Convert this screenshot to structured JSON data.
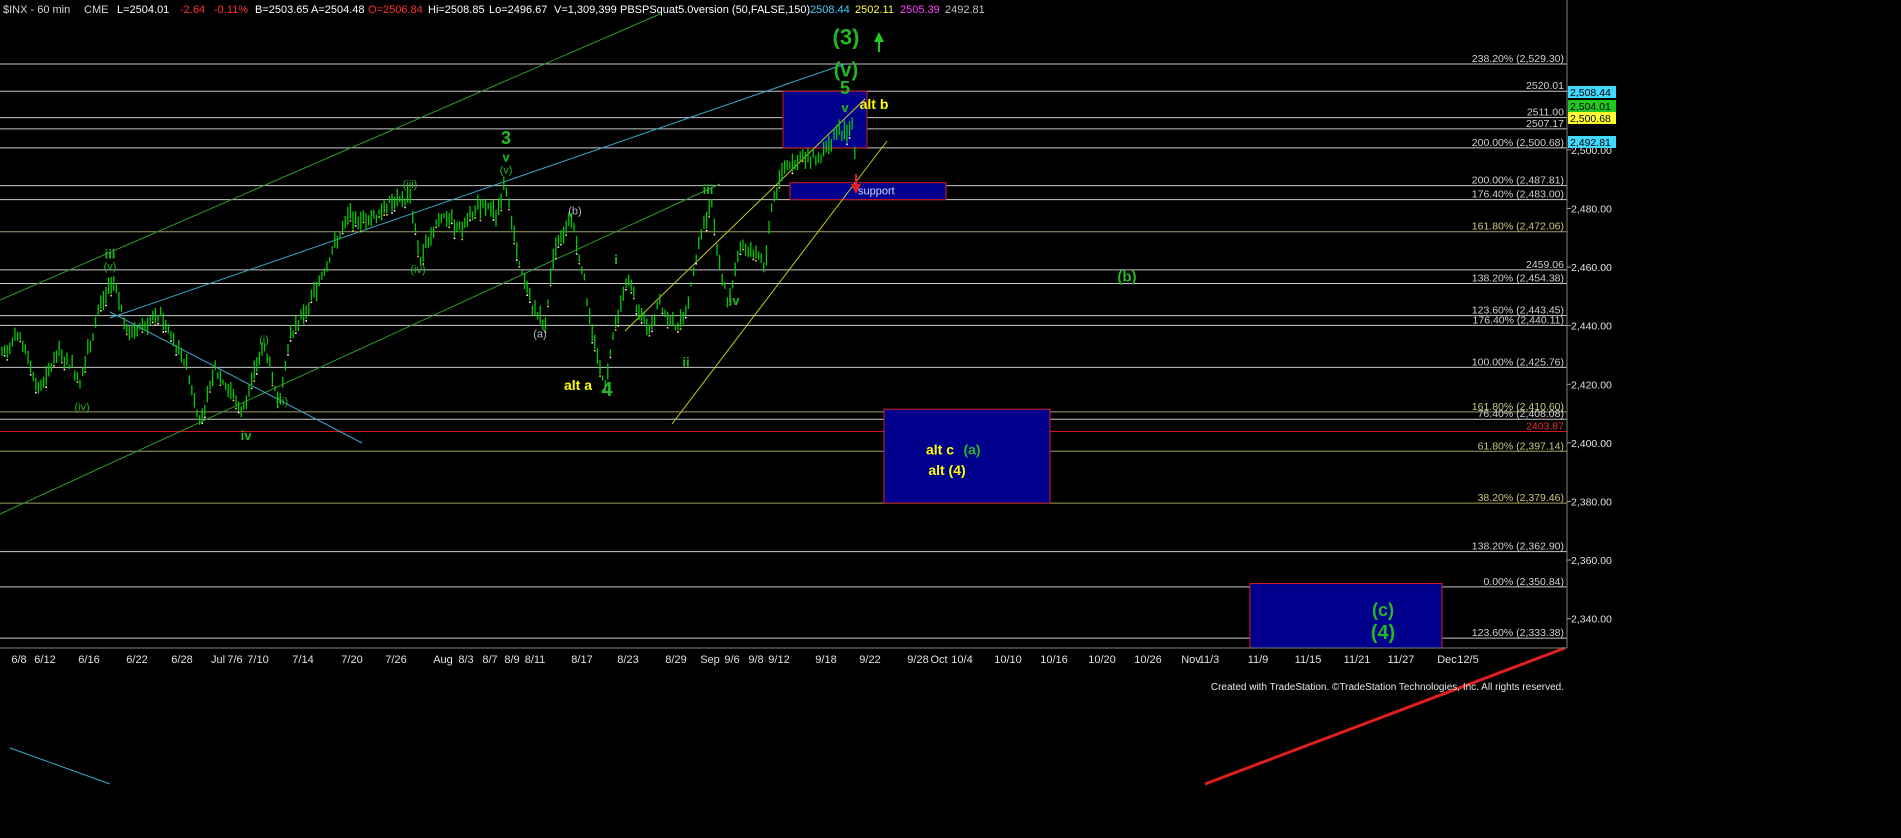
{
  "header": {
    "symbol": "$INX - 60 min",
    "exchange": "CME",
    "last": "L=2504.01",
    "change": "-2.64",
    "pct": "-0.11%",
    "bid": "B=2503.65",
    "ask": "A=2504.48",
    "open": "O=2506.84",
    "high": "Hi=2508.85",
    "low": "Lo=2496.67",
    "volume": "V=1,309,399",
    "study": "PBSPSquat5.0version (50,FALSE,150)",
    "v1": "2508.44",
    "v2": "2502.11",
    "v3": "2505.39",
    "v4": "2492.81"
  },
  "footer": "Created with TradeStation. ©TradeStation Technologies, Inc. All rights reserved.",
  "colors": {
    "background": "#000000",
    "up_bar": "#00cc00",
    "hline": "#c8c8c8",
    "red_line": "#d01818",
    "box_fill": "#00008c",
    "box_border": "#d02020",
    "green_label": "#22b822",
    "yellow_label": "#ffff00"
  },
  "chart_data": {
    "type": "candlestick",
    "ylim": [
      2330,
      2545
    ],
    "y_ticks": [
      "2,520.00",
      "2,500.00",
      "2,480.00",
      "2,460.00",
      "2,440.00",
      "2,420.00",
      "2,400.00",
      "2,380.00",
      "2,360.00",
      "2,340.00"
    ],
    "x_ticks": [
      "6/8",
      "6/12",
      "6/16",
      "6/22",
      "6/28",
      "Jul",
      "7/6",
      "7/10",
      "7/14",
      "7/20",
      "7/26",
      "Aug",
      "8/3",
      "8/7",
      "8/9",
      "8/11",
      "8/17",
      "8/23",
      "8/29",
      "Sep",
      "9/6",
      "9/8",
      "9/12",
      "9/18",
      "9/22",
      "9/28",
      "Oct",
      "10/4",
      "10/10",
      "10/16",
      "10/20",
      "10/26",
      "Nov",
      "11/3",
      "11/9",
      "11/15",
      "11/21",
      "11/27",
      "Dec",
      "12/5"
    ],
    "price_tags": [
      "2,508.44",
      "2,504.01",
      "2,500.68",
      "2,492.81"
    ],
    "levels": [
      {
        "label": "238.20% (2,529.30)",
        "value": 2529.3
      },
      {
        "label": "2520.01",
        "value": 2520.01
      },
      {
        "label": "2511.00",
        "value": 2511.0
      },
      {
        "label": "2507.17",
        "value": 2507.17
      },
      {
        "label": "200.00% (2,500.68)",
        "value": 2500.68
      },
      {
        "label": "200.00% (2,487.81)",
        "value": 2487.81
      },
      {
        "label": "176.40% (2,483.00)",
        "value": 2483.0
      },
      {
        "label": "161.80% (2,472.06)",
        "value": 2472.06
      },
      {
        "label": "2459.06",
        "value": 2459.06
      },
      {
        "label": "138.20% (2,454.38)",
        "value": 2454.38
      },
      {
        "label": "123.60% (2,443.45)",
        "value": 2443.45
      },
      {
        "label": "176.40% (2,440.11)",
        "value": 2440.11
      },
      {
        "label": "100.00% (2,425.76)",
        "value": 2425.76
      },
      {
        "label": "161.80% (2,410.60)",
        "value": 2410.6
      },
      {
        "label": "76.40% (2,408.08)",
        "value": 2408.08
      },
      {
        "label": "2403.87",
        "value": 2403.87
      },
      {
        "label": "61.80% (2,397.14)",
        "value": 2397.14
      },
      {
        "label": "38.20% (2,379.46)",
        "value": 2379.46
      },
      {
        "label": "138.20% (2,362.90)",
        "value": 2362.9
      },
      {
        "label": "0.00% (2,350.84)",
        "value": 2350.84
      },
      {
        "label": "123.60% (2,333.38)",
        "value": 2333.38
      }
    ],
    "path": [
      [
        0,
        2430
      ],
      [
        20,
        2436
      ],
      [
        40,
        2418
      ],
      [
        60,
        2432
      ],
      [
        80,
        2422
      ],
      [
        100,
        2446
      ],
      [
        112,
        2455
      ],
      [
        130,
        2437
      ],
      [
        160,
        2444
      ],
      [
        185,
        2428
      ],
      [
        200,
        2408
      ],
      [
        215,
        2425
      ],
      [
        230,
        2418
      ],
      [
        242,
        2410
      ],
      [
        255,
        2427
      ],
      [
        265,
        2433
      ],
      [
        278,
        2413
      ],
      [
        290,
        2437
      ],
      [
        310,
        2448
      ],
      [
        330,
        2464
      ],
      [
        350,
        2478
      ],
      [
        370,
        2476
      ],
      [
        390,
        2482
      ],
      [
        410,
        2484
      ],
      [
        420,
        2462
      ],
      [
        440,
        2478
      ],
      [
        460,
        2473
      ],
      [
        480,
        2481
      ],
      [
        497,
        2478
      ],
      [
        505,
        2490
      ],
      [
        518,
        2462
      ],
      [
        530,
        2448
      ],
      [
        545,
        2440
      ],
      [
        555,
        2468
      ],
      [
        572,
        2476
      ],
      [
        583,
        2458
      ],
      [
        595,
        2432
      ],
      [
        605,
        2419
      ],
      [
        615,
        2441
      ],
      [
        628,
        2456
      ],
      [
        640,
        2443
      ],
      [
        650,
        2440
      ],
      [
        660,
        2448
      ],
      [
        672,
        2440
      ],
      [
        685,
        2442
      ],
      [
        700,
        2470
      ],
      [
        712,
        2483
      ],
      [
        720,
        2460
      ],
      [
        728,
        2447
      ],
      [
        740,
        2467
      ],
      [
        755,
        2466
      ],
      [
        765,
        2460
      ],
      [
        772,
        2482
      ],
      [
        785,
        2495
      ],
      [
        800,
        2498
      ],
      [
        818,
        2497
      ],
      [
        830,
        2504
      ],
      [
        842,
        2506
      ],
      [
        852,
        2508
      ],
      [
        856,
        2498
      ]
    ],
    "waves": [
      {
        "text": "iii",
        "price": 2463,
        "x": 110,
        "color": "green",
        "size": 13,
        "bold": true
      },
      {
        "text": "(v)",
        "price": 2459,
        "x": 110,
        "color": "green",
        "size": 11
      },
      {
        "text": "(iv)",
        "price": 2411,
        "x": 82,
        "color": "green",
        "size": 11
      },
      {
        "text": "(i)",
        "price": 2434,
        "x": 264,
        "color": "green",
        "size": 11
      },
      {
        "text": "(ii)",
        "price": 2413,
        "x": 282,
        "color": "green",
        "size": 11
      },
      {
        "text": "iv",
        "price": 2401,
        "x": 246,
        "color": "green",
        "size": 13,
        "bold": true
      },
      {
        "text": "(iii)",
        "price": 2487,
        "x": 410,
        "color": "green",
        "size": 11
      },
      {
        "text": "(iv)",
        "price": 2458,
        "x": 418,
        "color": "green",
        "size": 11
      },
      {
        "text": "3",
        "price": 2502,
        "x": 506,
        "color": "green",
        "size": 18,
        "bold": true
      },
      {
        "text": "v",
        "price": 2496,
        "x": 506,
        "color": "green",
        "size": 13,
        "bold": true
      },
      {
        "text": "(v)",
        "price": 2492,
        "x": 506,
        "color": "green",
        "size": 11
      },
      {
        "text": "(a)",
        "price": 2436,
        "x": 540,
        "color": "grey",
        "size": 11
      },
      {
        "text": "(b)",
        "price": 2478,
        "x": 575,
        "color": "grey",
        "size": 11
      },
      {
        "text": "alt a",
        "price": 2418,
        "x": 578,
        "color": "yellow",
        "size": 14,
        "bold": true
      },
      {
        "text": "4",
        "price": 2416,
        "x": 607,
        "color": "green",
        "size": 20,
        "bold": true
      },
      {
        "text": "i",
        "price": 2461,
        "x": 616,
        "color": "green",
        "size": 13,
        "bold": true
      },
      {
        "text": "ii",
        "price": 2426,
        "x": 686,
        "color": "green",
        "size": 13,
        "bold": true
      },
      {
        "text": "iii",
        "price": 2485,
        "x": 708,
        "color": "green",
        "size": 13,
        "bold": true
      },
      {
        "text": "iv",
        "price": 2447,
        "x": 734,
        "color": "green",
        "size": 13,
        "bold": true
      },
      {
        "text": "(3)",
        "price": 2536,
        "x": 846,
        "color": "green",
        "size": 22,
        "bold": true
      },
      {
        "text": "(v)",
        "price": 2525,
        "x": 846,
        "color": "green",
        "size": 20,
        "bold": true
      },
      {
        "text": "5",
        "price": 2519,
        "x": 845,
        "color": "green",
        "size": 18,
        "bold": true
      },
      {
        "text": "v",
        "price": 2513,
        "x": 845,
        "color": "green",
        "size": 13,
        "bold": true
      },
      {
        "text": "alt b",
        "price": 2514,
        "x": 874,
        "color": "yellow",
        "size": 14,
        "bold": true
      },
      {
        "text": "(b)",
        "price": 2455,
        "x": 1127,
        "color": "green",
        "size": 15,
        "bold": true
      },
      {
        "text": "alt c",
        "price": 2396,
        "x": 940,
        "color": "yellow",
        "size": 14,
        "bold": true
      },
      {
        "text": "(a)",
        "price": 2396,
        "x": 972,
        "color": "green",
        "size": 14,
        "bold": true
      },
      {
        "text": "alt (4)",
        "price": 2389,
        "x": 947,
        "color": "yellow",
        "size": 14,
        "bold": true
      },
      {
        "text": "(c)",
        "price": 2341,
        "x": 1383,
        "color": "green",
        "size": 18,
        "bold": true
      },
      {
        "text": "(4)",
        "price": 2333,
        "x": 1383,
        "color": "green",
        "size": 20,
        "bold": true
      }
    ],
    "boxes": [
      {
        "x1": 783,
        "x2": 867,
        "p1": 2520.01,
        "p2": 2500.68
      },
      {
        "x1": 790,
        "x2": 946,
        "p1": 2488.8,
        "p2": 2483.0,
        "label": "support"
      },
      {
        "x1": 884,
        "x2": 1050,
        "p1": 2411.5,
        "p2": 2379.46
      },
      {
        "x1": 1250,
        "x2": 1442,
        "p1": 2352,
        "p2": 2330
      }
    ]
  }
}
